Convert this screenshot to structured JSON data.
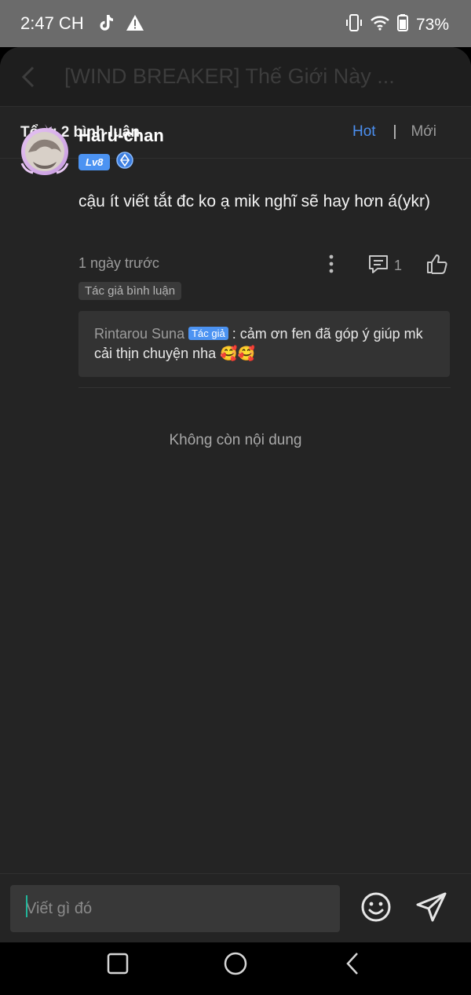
{
  "status": {
    "time": "2:47 CH",
    "battery": "73%",
    "icons": [
      "tiktok-icon",
      "warning-icon",
      "vibrate-icon",
      "wifi-icon",
      "battery-icon"
    ]
  },
  "header": {
    "title": "[WIND BREAKER] Thế Giới Này ..."
  },
  "summary": {
    "count_label": "Tổng 2 bình luận",
    "sort_hot": "Hot",
    "sort_separator": "|",
    "sort_new": "Mới"
  },
  "comment": {
    "username": "Haru-chan",
    "level": "Lv8",
    "text": "cậu ít viết tắt đc ko ạ mik nghĩ sẽ hay hơn á(ykr)",
    "time": "1 ngày trước",
    "reply_count": "1",
    "author_tag": "Tác giả bình luận",
    "reply": {
      "author": "Rintarou Suna",
      "badge": "Tác giả",
      "text": " : cảm ơn fen đã góp ý giúp mk cải thịn chuyện nha 🥰🥰"
    }
  },
  "end_text": "Không còn nội dung",
  "composer": {
    "placeholder": "Viết gì đó"
  },
  "colors": {
    "accent": "#4b8ff0",
    "background": "#242424",
    "status_bar": "#6b6b6b",
    "cursor": "#22b59a"
  }
}
